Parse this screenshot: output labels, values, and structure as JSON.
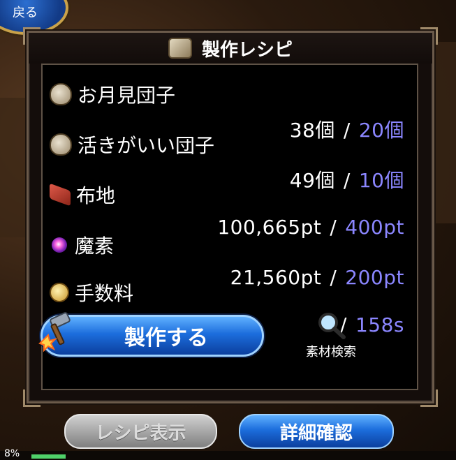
{
  "header": {
    "back_label": "戻る"
  },
  "panel": {
    "title": "製作レシピ"
  },
  "materials": [
    {
      "name": "お月見団子",
      "icon": "dango-bag-icon",
      "owned": "38個",
      "separator": "/",
      "required": "20個"
    },
    {
      "name": "活きがいい団子",
      "icon": "dango-bag-icon",
      "owned": "49個",
      "separator": "/",
      "required": "10個"
    },
    {
      "name": "布地",
      "icon": "cloth-icon",
      "owned": "100,665pt",
      "separator": "/",
      "required": "400pt"
    },
    {
      "name": "魔素",
      "icon": "magic-orb-icon",
      "owned": "21,560pt",
      "separator": "/",
      "required": "200pt"
    },
    {
      "name": "手数料",
      "icon": "coin-icon",
      "owned": "",
      "separator": "/",
      "required": "158s"
    }
  ],
  "actions": {
    "craft_label": "製作する",
    "search_label": "素材検索",
    "recipe_label": "レシピ表示",
    "detail_label": "詳細確認"
  },
  "footer": {
    "progress_label": "8%",
    "progress": 0.08
  },
  "colors": {
    "required_value": "#8b86ff",
    "primary_button": "#1c6ddc"
  }
}
